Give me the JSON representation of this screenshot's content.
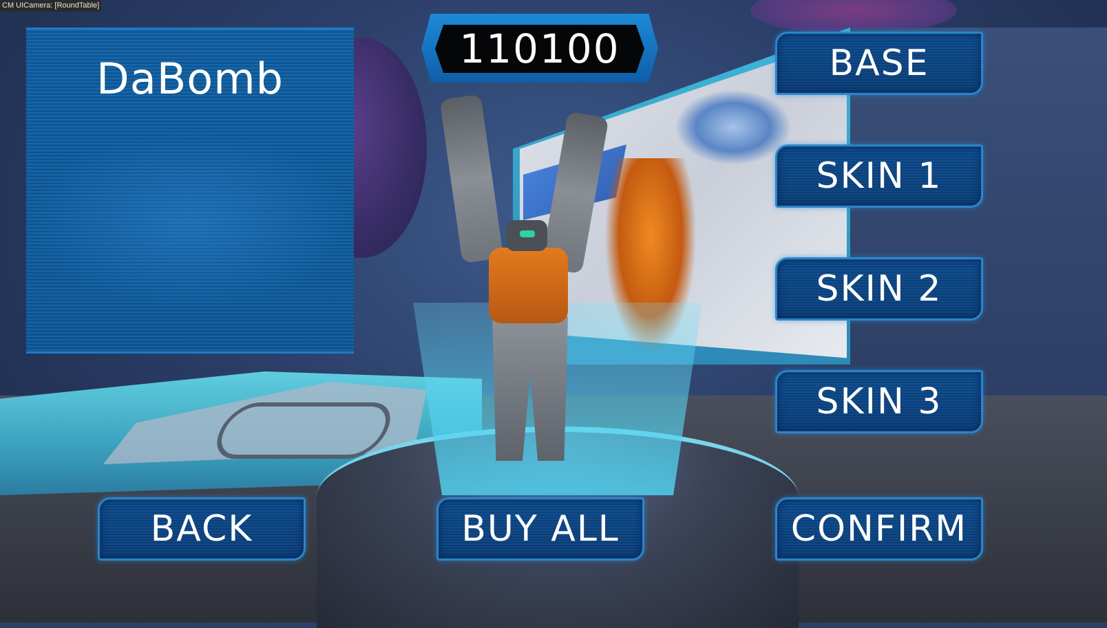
{
  "camera_label": "CM UICamera: [RoundTable]",
  "robot_name": "DaBomb",
  "currency": "110100",
  "skins": [
    {
      "id": "base",
      "label": "BASE"
    },
    {
      "id": "skin1",
      "label": "SKIN 1"
    },
    {
      "id": "skin2",
      "label": "SKIN 2"
    },
    {
      "id": "skin3",
      "label": "SKIN 3"
    }
  ],
  "actions": {
    "back": "BACK",
    "buy_all": "BUY ALL",
    "confirm": "CONFIRM"
  },
  "colors": {
    "panel_blue": "#0f5fa3",
    "button_fill": "#0b4a8c",
    "button_border": "#2a85cc",
    "hologram_cyan": "#63d5e6"
  }
}
